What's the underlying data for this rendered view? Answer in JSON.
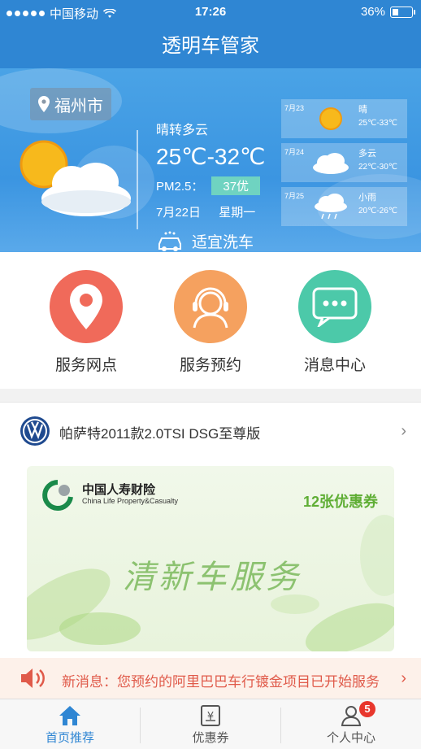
{
  "status_bar": {
    "carrier": "中国移动",
    "time": "17:26",
    "battery": "36%",
    "battery_level": 0.36
  },
  "nav": {
    "title": "透明车管家"
  },
  "weather": {
    "city": "福州市",
    "today": {
      "condition": "晴转多云",
      "temperature": "25℃-32℃",
      "pm_label": "PM2.5：",
      "aqi": "37优",
      "date": "7月22日",
      "weekday": "星期一",
      "wash_text": "适宜洗车"
    },
    "forecast": [
      {
        "date": "7月23",
        "condition": "晴",
        "temperature": "25℃-33℃",
        "icon": "sun-icon"
      },
      {
        "date": "7月24",
        "condition": "多云",
        "temperature": "22℃-30℃",
        "icon": "cloud-icon"
      },
      {
        "date": "7月25",
        "condition": "小雨",
        "temperature": "20℃-26℃",
        "icon": "rain-icon"
      }
    ]
  },
  "services": [
    {
      "label": "服务网点",
      "icon": "location-pin-icon",
      "color": "#f06a5a"
    },
    {
      "label": "服务预约",
      "icon": "customer-service-icon",
      "color": "#f5a15f"
    },
    {
      "label": "消息中心",
      "icon": "message-icon",
      "color": "#4cc9a9"
    }
  ],
  "car": {
    "name": "帕萨特2011款2.0TSI DSG至尊版"
  },
  "banner": {
    "company": "中国人寿财险",
    "company_en": "China Life Property&Casualty",
    "coupon": "12张优惠券",
    "slogan": "清新车服务"
  },
  "notice": {
    "text": "新消息：您预约的阿里巴巴车行镀金项目已开始服务"
  },
  "tabs": [
    {
      "label": "首页推荐",
      "active": true
    },
    {
      "label": "优惠券",
      "active": false
    },
    {
      "label": "个人中心",
      "active": false,
      "badge": "5"
    }
  ],
  "colors": {
    "primary": "#2f86d3",
    "notice": "#e05a4a"
  }
}
